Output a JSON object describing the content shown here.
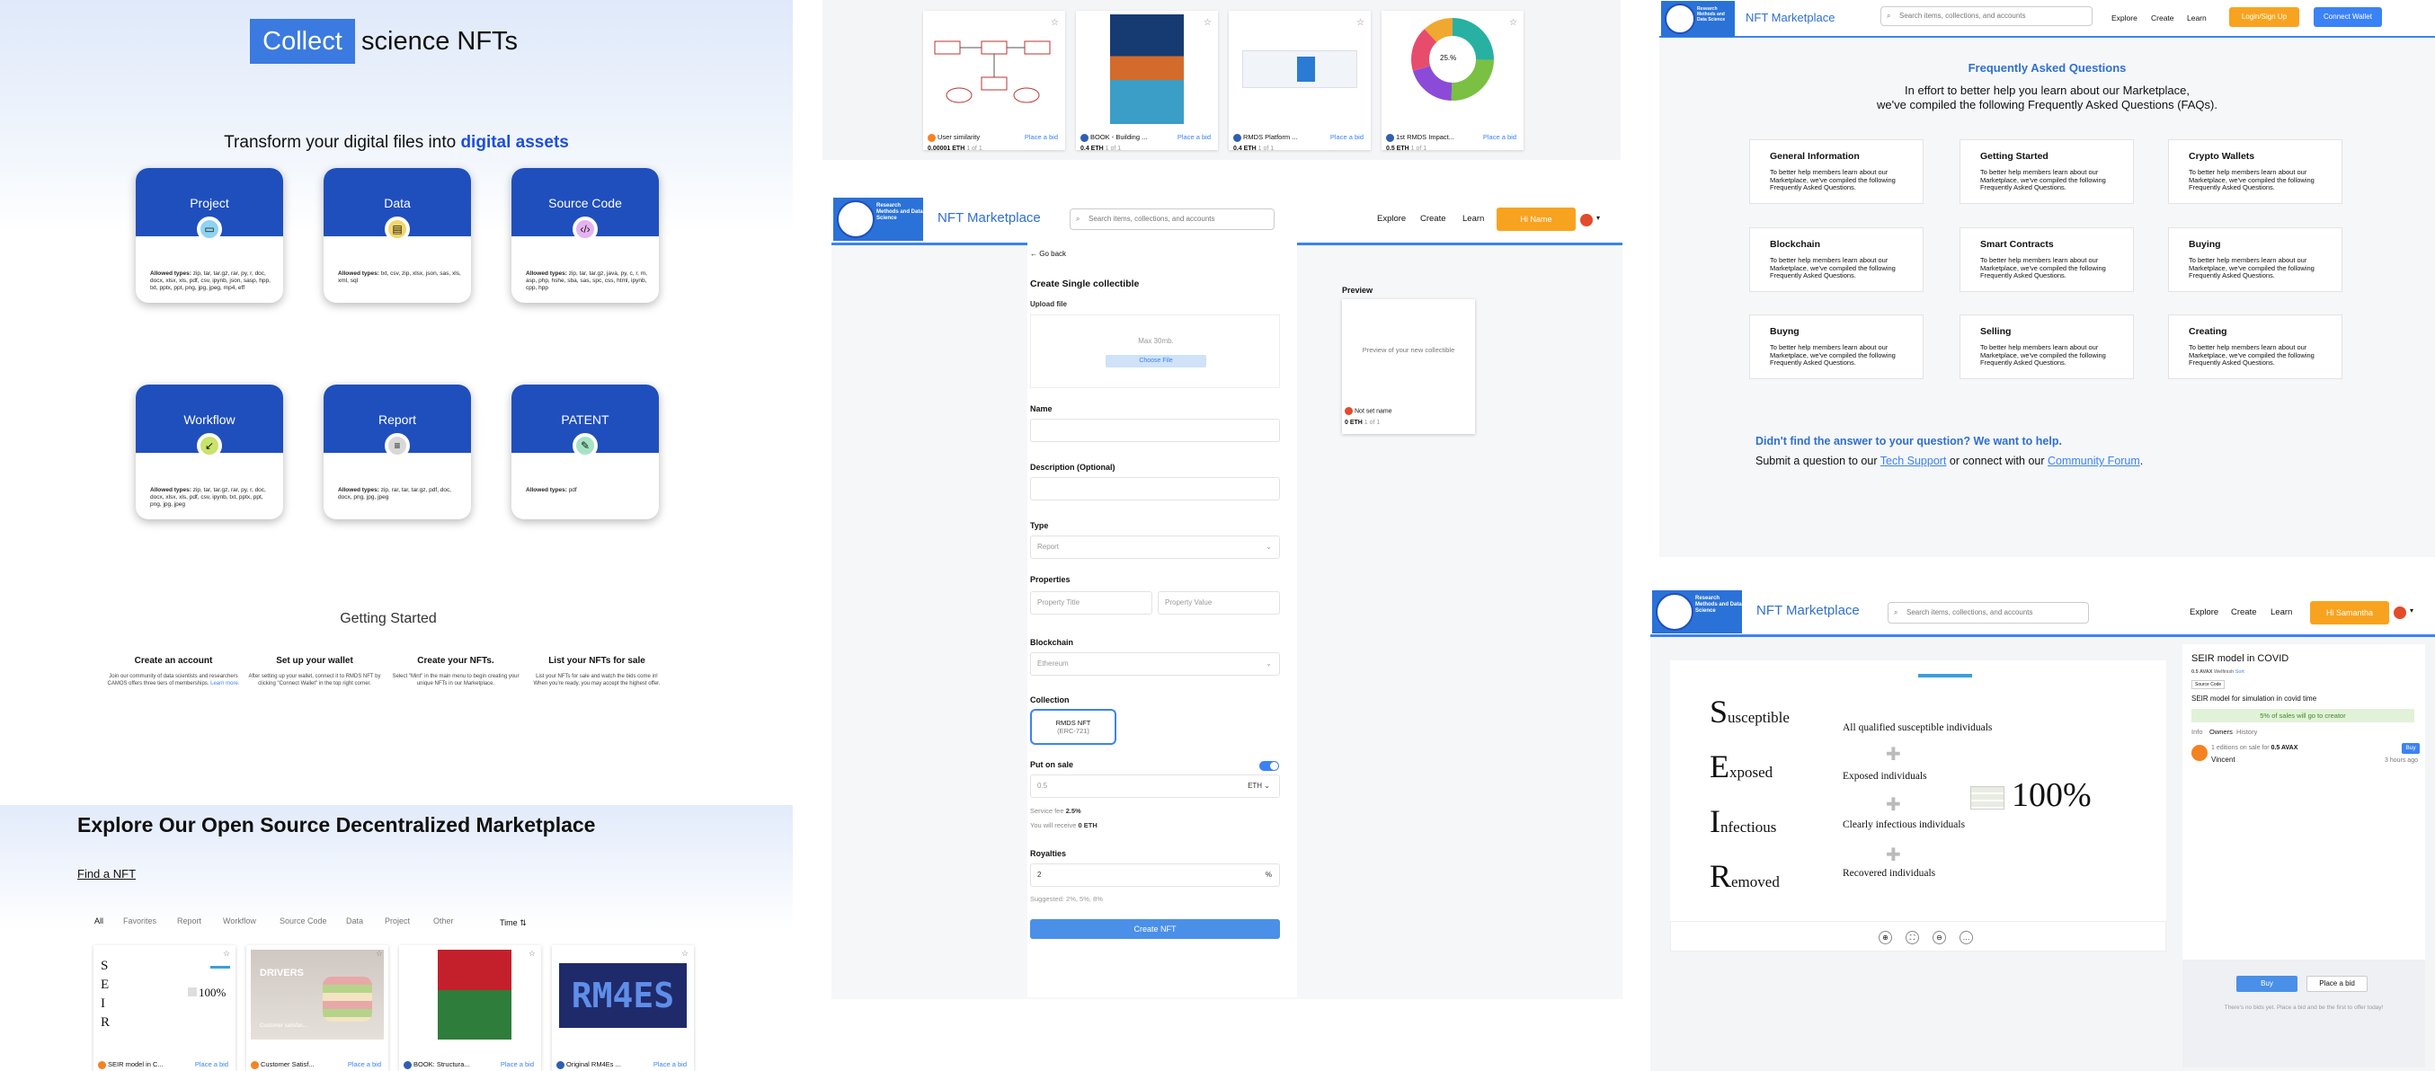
{
  "create_page": {
    "hero_highlight": "Collect",
    "hero_rest": "science NFTs",
    "subtitle_prefix": "Transform your digital files into",
    "subtitle_highlight": "digital assets",
    "cards": [
      {
        "title": "Project",
        "allowed_label": "Allowed types:",
        "allowed": "zip, tar, tar.gz, rar, py, r, doc, docx, xlsx, xls, pdf, csv, ipynb, json, sasp, hpp, txt, pptx, ppt, png, jpg, jpeg, mp4, eff"
      },
      {
        "title": "Data",
        "allowed_label": "Allowed types:",
        "allowed": "txt, csv, zip, xlsx, json, sas, xls, xml, sql"
      },
      {
        "title": "Source Code",
        "allowed_label": "Allowed types:",
        "allowed": "zip, tar, tar.gz, java, py, c, r, m, asp, php, hshe, sba, sas, spc, css, html, ipynb, cpp, hpp"
      },
      {
        "title": "Workflow",
        "allowed_label": "Allowed types:",
        "allowed": "zip, tar, tar.gz, rar, py, r, doc, docx, xlsx, xls, pdf, csv, ipynb, txt, pptx, ppt, png, jpg, jpeg"
      },
      {
        "title": "Report",
        "allowed_label": "Allowed types:",
        "allowed": "zip, rar, tar, tar.gz, pdf, doc, docx, png, jpg, jpeg"
      },
      {
        "title": "PATENT",
        "allowed_label": "Allowed types:",
        "allowed": "pdf"
      }
    ],
    "getting_started": "Getting Started",
    "steps": [
      {
        "title": "Create an account",
        "desc": "Join our community of data scientists and researchers CAMOS offers three tiers of memberships.",
        "link": "Learn more."
      },
      {
        "title": "Set up your wallet",
        "desc": "After setting up your wallet, connect it to RMDS NFT by clicking \"Connect Wallet\" in the top right corner."
      },
      {
        "title": "Create your NFTs.",
        "desc": "Select \"Mint\" in the main menu to begin creating your unique NFTs in our Marketplace."
      },
      {
        "title": "List your NFTs for sale",
        "desc": "List your NFTs for sale and watch the bids come in! When you're ready, you may accept the highest offer."
      }
    ]
  },
  "explore": {
    "title": "Explore Our Open Source Decentralized Marketplace",
    "find": "Find a NFT",
    "filters": [
      "All",
      "Favorites",
      "Report",
      "Workflow",
      "Source Code",
      "Data",
      "Project",
      "Other"
    ],
    "sort": "Time",
    "items": [
      {
        "name": "SEIR model in C...",
        "bid": "Place a bid"
      },
      {
        "name": "Customer Satisf...",
        "bid": "Place a bid"
      },
      {
        "name": "BOOK: Structura...",
        "bid": "Place a bid"
      },
      {
        "name": "Original RM4Es ...",
        "bid": "Place a bid"
      }
    ],
    "banner_text": "RM4ES",
    "drivers_text": "DRIVERS",
    "macaron_text": "Customer satisfac..."
  },
  "grid": {
    "items": [
      {
        "name": "User similarity",
        "bid": "Place a bid",
        "price": "0.00001 ETH",
        "count": "1 of 1"
      },
      {
        "name": "BOOK - Building ...",
        "bid": "Place a bid",
        "price": "0.4 ETH",
        "count": "1 of 1"
      },
      {
        "name": "RMDS Platform ...",
        "bid": "Place a bid",
        "price": "0.4 ETH",
        "count": "1 of 1"
      },
      {
        "name": "1st RMDS Impact...",
        "bid": "Place a bid",
        "price": "0.5 ETH",
        "count": "1 of 1"
      }
    ],
    "donut_center": "25.%"
  },
  "mint": {
    "logo_text": "Research Methods and Data Science",
    "brand": "NFT Marketplace",
    "search_placeholder": "Search items, collections, and accounts",
    "nav": [
      "Explore",
      "Create",
      "Learn"
    ],
    "user_button": "Hi Name",
    "back": "Go back",
    "title": "Create Single collectible",
    "upload_label": "Upload file",
    "upload_hint": "Max 30mb.",
    "choose": "Choose File",
    "preview_title": "Preview",
    "preview_text": "Preview of your new collectible",
    "preview_owner": "Not set name",
    "preview_price": "0 ETH",
    "preview_count": "1 of 1",
    "name_label": "Name",
    "desc_label": "Description (Optional)",
    "type_label": "Type",
    "type_value": "Report",
    "props_label": "Properties",
    "prop_title": "Property Title",
    "prop_value": "Property Value",
    "chain_label": "Blockchain",
    "chain_value": "Ethereum",
    "collection_label": "Collection",
    "collection_name": "RMDS NFT",
    "collection_std": "(ERC-721)",
    "sale_label": "Put on sale",
    "sale_placeholder": "0.5",
    "sale_currency": "ETH",
    "fee_label": "Service fee",
    "fee_value": "2.5%",
    "receive_label": "You will receive",
    "receive_value": "0 ETH",
    "royal_label": "Royalties",
    "royal_value": "2",
    "royal_unit": "%",
    "suggested": "Suggested: 2%, 5%, 8%",
    "create": "Create NFT"
  },
  "faq": {
    "logo_text": "Research Methods and Data Science",
    "brand": "NFT Marketplace",
    "search_placeholder": "Search items, collections, and accounts",
    "nav": [
      "Explore",
      "Create",
      "Learn"
    ],
    "login": "Login/Sign Up",
    "connect": "Connect Wallet",
    "title": "Frequently Asked Questions",
    "intro1": "In effort to better help you learn about our Marketplace,",
    "intro2": "we've compiled the following Frequently Asked Questions (FAQs).",
    "cards": [
      "General Information",
      "Getting Started",
      "Crypto Wallets",
      "Blockchain",
      "Smart Contracts",
      "Buying",
      "Buyng",
      "Selling",
      "Creating"
    ],
    "card_desc": "To better help members learn about our Marketplace, we've compiled the following Frequently Asked Questions.",
    "help_title": "Didn't find the answer to your question? We want to help.",
    "help_pre": "Submit a question to our",
    "help_link1": "Tech Support",
    "help_mid": "or connect with our",
    "help_link2": "Community Forum",
    "help_end": "."
  },
  "detail": {
    "brand": "NFT Marketplace",
    "search_placeholder": "Search items, collections, and accounts",
    "nav": [
      "Explore",
      "Create",
      "Learn"
    ],
    "user": "Hi Samantha",
    "title": "SEIR model in COVID",
    "meta1": "0.5 AVAX",
    "meta2": "Welfinish",
    "meta3": "Sort",
    "badge": "Source Code",
    "desc": "SEIR model for simulation in covid time",
    "royalty": "5% of sales will go to creator",
    "tabs": [
      "Info",
      "Owners",
      "History"
    ],
    "offer": "1 editions on sale for",
    "offer_price": "0.5 AVAX",
    "buy_small": "Buy",
    "owner": "Vincent",
    "ago": "3 hours ago",
    "buy": "Buy",
    "place_bid": "Place a bid",
    "no_bids": "There's no bids yet. Place a bid and be the first to offer today!",
    "seir": [
      {
        "l": "S",
        "r": "usceptible",
        "t": "All qualified susceptible individuals"
      },
      {
        "l": "E",
        "r": "xposed",
        "t": "Exposed individuals"
      },
      {
        "l": "I",
        "r": "nfectious",
        "t": "Clearly infectious individuals"
      },
      {
        "l": "R",
        "r": "emoved",
        "t": "Recovered individuals"
      }
    ],
    "pct": "100%"
  },
  "colors": {
    "blue": "#1f4fbd",
    "accent": "#3b82f6",
    "orange": "#f8a31f"
  }
}
